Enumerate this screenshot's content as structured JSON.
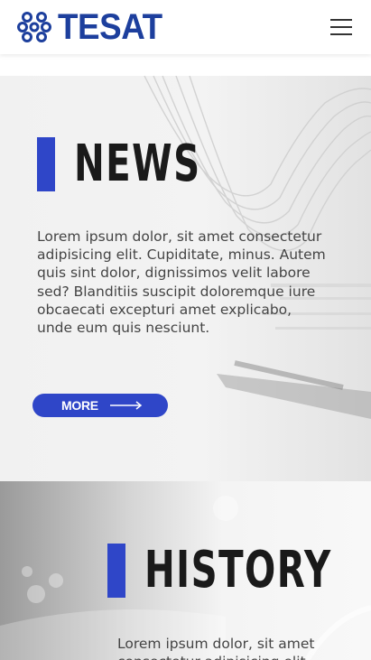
{
  "brand": {
    "name": "TESAT",
    "color": "#1d3f9d",
    "accent": "#2f46c8"
  },
  "header": {
    "menu_icon": "hamburger-menu-icon",
    "logo_icon": "molecule-logo-icon"
  },
  "news": {
    "title": "NEWS",
    "body": "Lorem ipsum dolor, sit amet consectetur adipisicing elit. Cupiditate, minus. Autem quis sint dolor, dignissimos velit labore sed? Blanditiis suscipit doloremque iure obcaecati excepturi amet explicabo, unde eum quis nesciunt.",
    "button_label": "MORE",
    "button_icon": "arrow-right-icon"
  },
  "history": {
    "title": "HISTORY",
    "body": "Lorem ipsum dolor, sit amet consectetur adipisicing elit."
  }
}
